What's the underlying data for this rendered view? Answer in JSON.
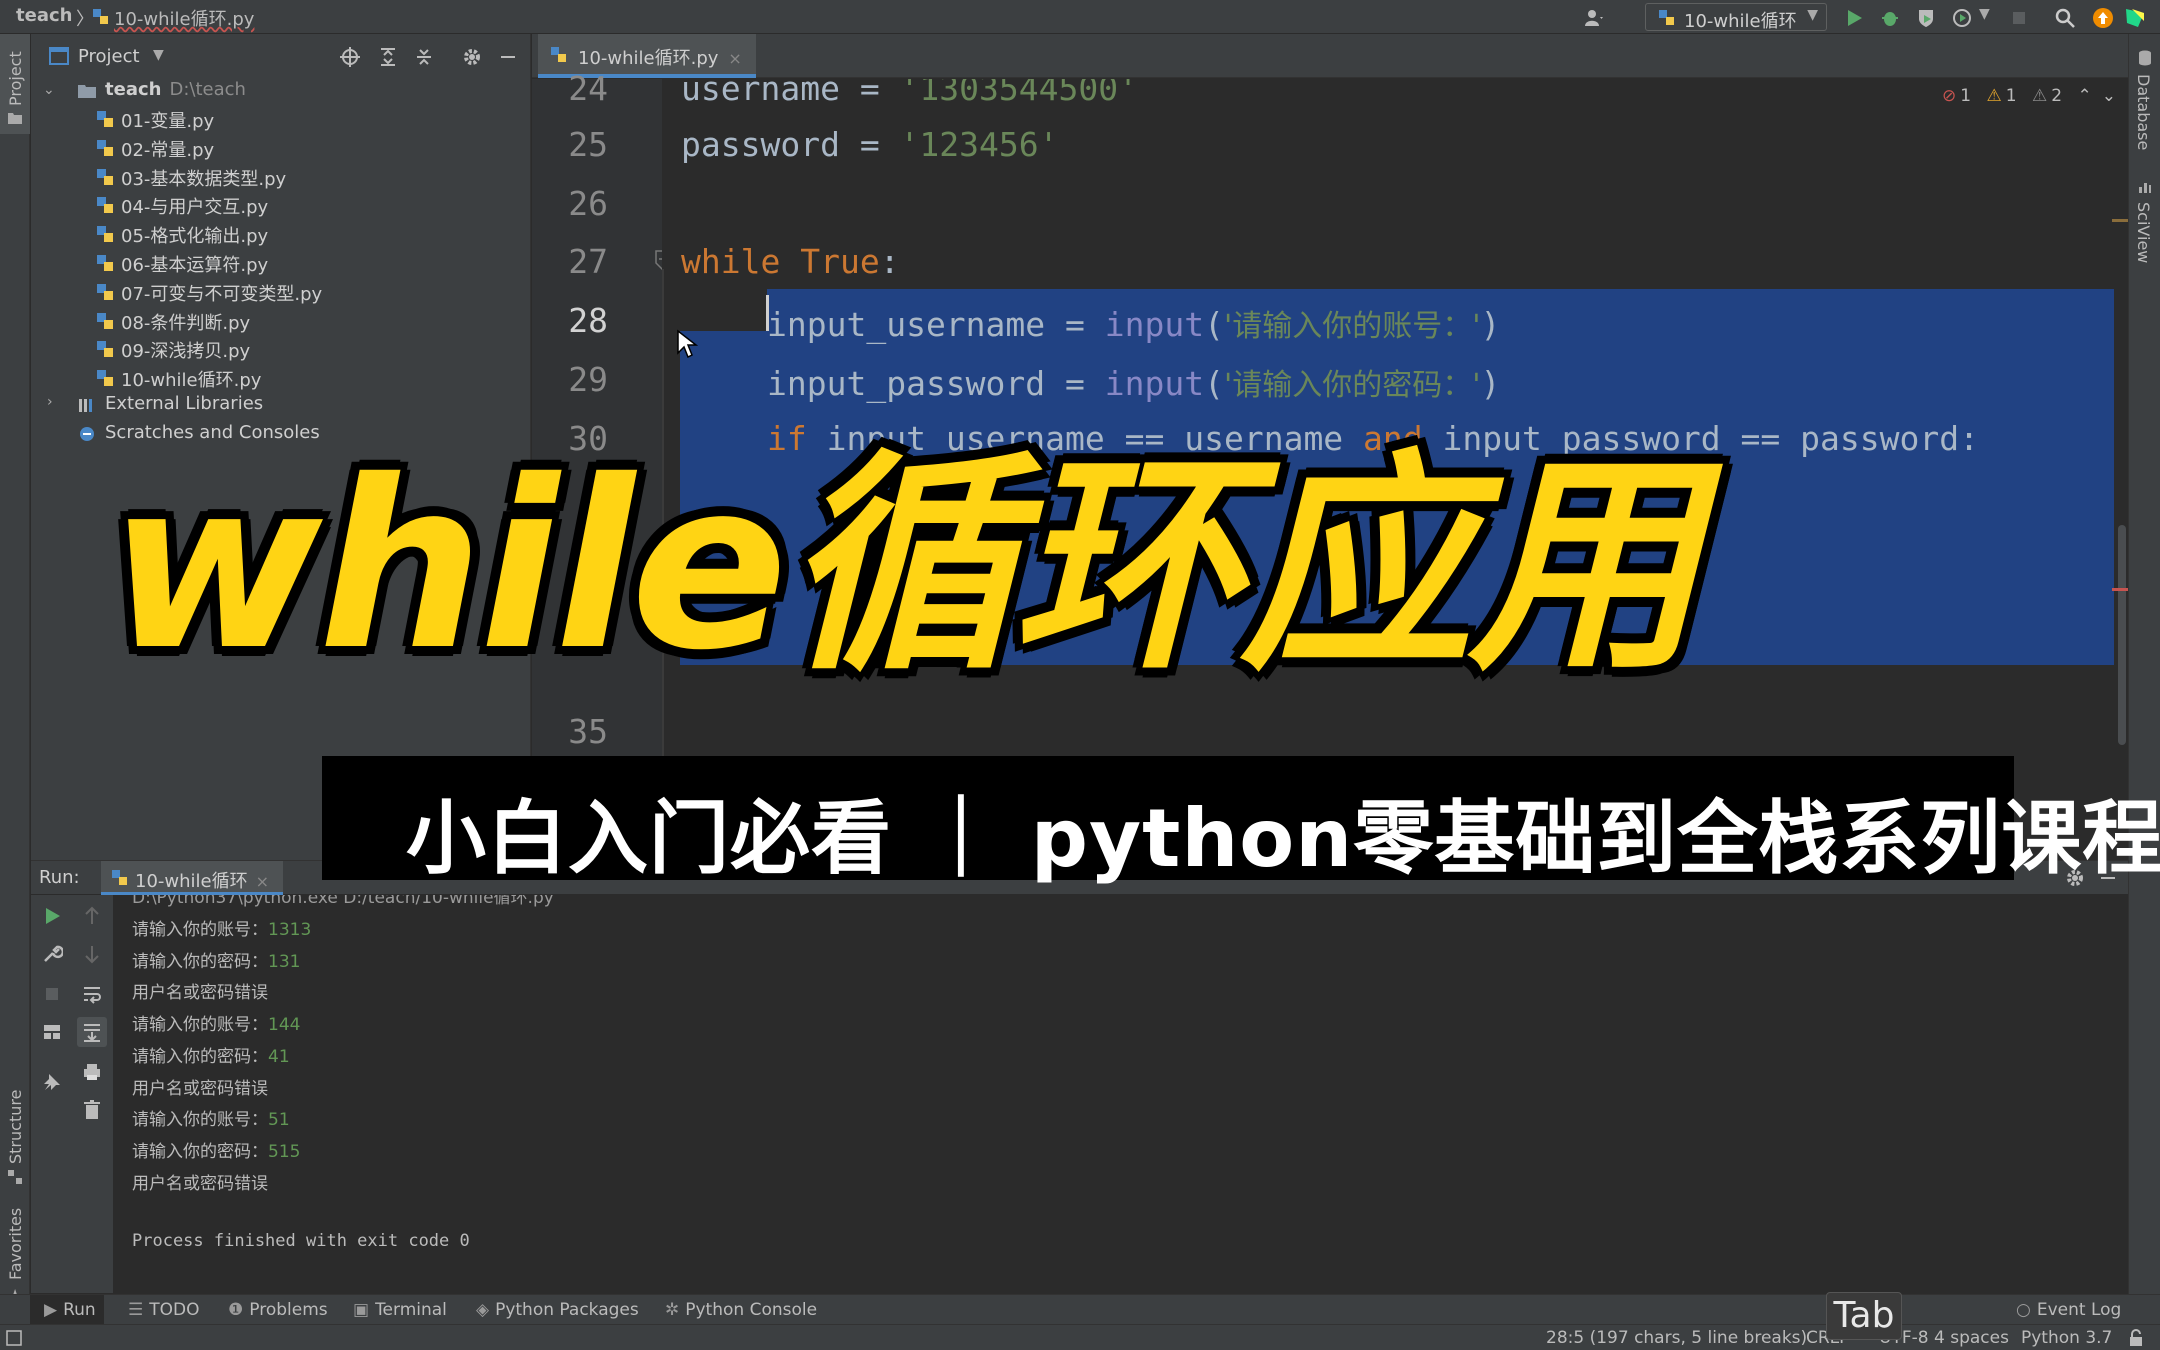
{
  "titlebar": {
    "project": "teach",
    "separator": "〉",
    "file": "10-while循环.py",
    "run_config": "10-while循环"
  },
  "sidebar_left": {
    "project_tool": "Project",
    "structure_tool": "Structure",
    "favorites_tool": "Favorites"
  },
  "sidebar_right": {
    "database_tool": "Database",
    "sciview_tool": "SciView"
  },
  "project_panel": {
    "title": "Project",
    "root": {
      "name": "teach",
      "path": "D:\\teach"
    },
    "files": [
      "01-变量.py",
      "02-常量.py",
      "03-基本数据类型.py",
      "04-与用户交互.py",
      "05-格式化输出.py",
      "06-基本运算符.py",
      "07-可变与不可变类型.py",
      "08-条件判断.py",
      "09-深浅拷贝.py",
      "10-while循环.py"
    ],
    "external_libraries": "External Libraries",
    "scratches": "Scratches and Consoles"
  },
  "editor": {
    "tab_label": "10-while循环.py",
    "tab_close": "×",
    "inspections": {
      "errors": "1",
      "warnings": "1",
      "weak_warnings": "2"
    },
    "line_numbers": [
      "24",
      "25",
      "26",
      "27",
      "28",
      "29",
      "30",
      "35"
    ],
    "line24": {
      "var": "username",
      "op": " = ",
      "val": "'1303544500'"
    },
    "line25": {
      "var": "password",
      "op": " = ",
      "val": "'123456'"
    },
    "line27": {
      "kw1": "while",
      "kw2": "True",
      "colon": ":"
    },
    "line28": {
      "var": "input_username",
      "op": " = ",
      "fn": "input",
      "open": "(",
      "str": "'请输入你的账号：'",
      "close": ")"
    },
    "line29": {
      "var": "input_password",
      "op": " = ",
      "fn": "input",
      "open": "(",
      "str": "'请输入你的密码：'",
      "close": ")"
    },
    "line30": {
      "kw_if": "if",
      "a": " input_username == username ",
      "kw_and": "and",
      "b": " input_password == password:"
    }
  },
  "run_panel": {
    "label": "Run:",
    "tab": "10-while循环",
    "tab_close": "×",
    "command": "D:\\Python37\\python.exe D:/teach/10-while循环.py",
    "output": [
      {
        "prompt": "请输入你的账号：",
        "input": "1313"
      },
      {
        "prompt": "请输入你的密码：",
        "input": "131"
      },
      {
        "prompt": "用户名或密码错误",
        "input": ""
      },
      {
        "prompt": "请输入你的账号：",
        "input": "144"
      },
      {
        "prompt": "请输入你的密码：",
        "input": "41"
      },
      {
        "prompt": "用户名或密码错误",
        "input": ""
      },
      {
        "prompt": "请输入你的账号：",
        "input": "51"
      },
      {
        "prompt": "请输入你的密码：",
        "input": "515"
      },
      {
        "prompt": "用户名或密码错误",
        "input": ""
      }
    ],
    "exit_message": "Process finished with exit code 0"
  },
  "tool_tabs": {
    "run": "Run",
    "todo": "TODO",
    "problems": "Problems",
    "terminal": "Terminal",
    "python_packages": "Python Packages",
    "python_console": "Python Console",
    "event_log": "Event Log"
  },
  "status_bar": {
    "position": "28:5 (197 chars, 5 line breaks)",
    "line_sep": "CRLF",
    "encoding": "UTF-8",
    "indent": "4 spaces",
    "interpreter": "Python 3.7"
  },
  "key_overlay": "Tab",
  "overlay": {
    "title": "while循环应用",
    "subtitle": "小白入门必看 ｜ python零基础到全栈系列课程"
  },
  "colors": {
    "title_yellow": "#ffd414",
    "selection": "#214283",
    "keyword": "#cc7832",
    "string": "#6a8759",
    "builtin": "#8888c6",
    "console_input": "#629755"
  }
}
